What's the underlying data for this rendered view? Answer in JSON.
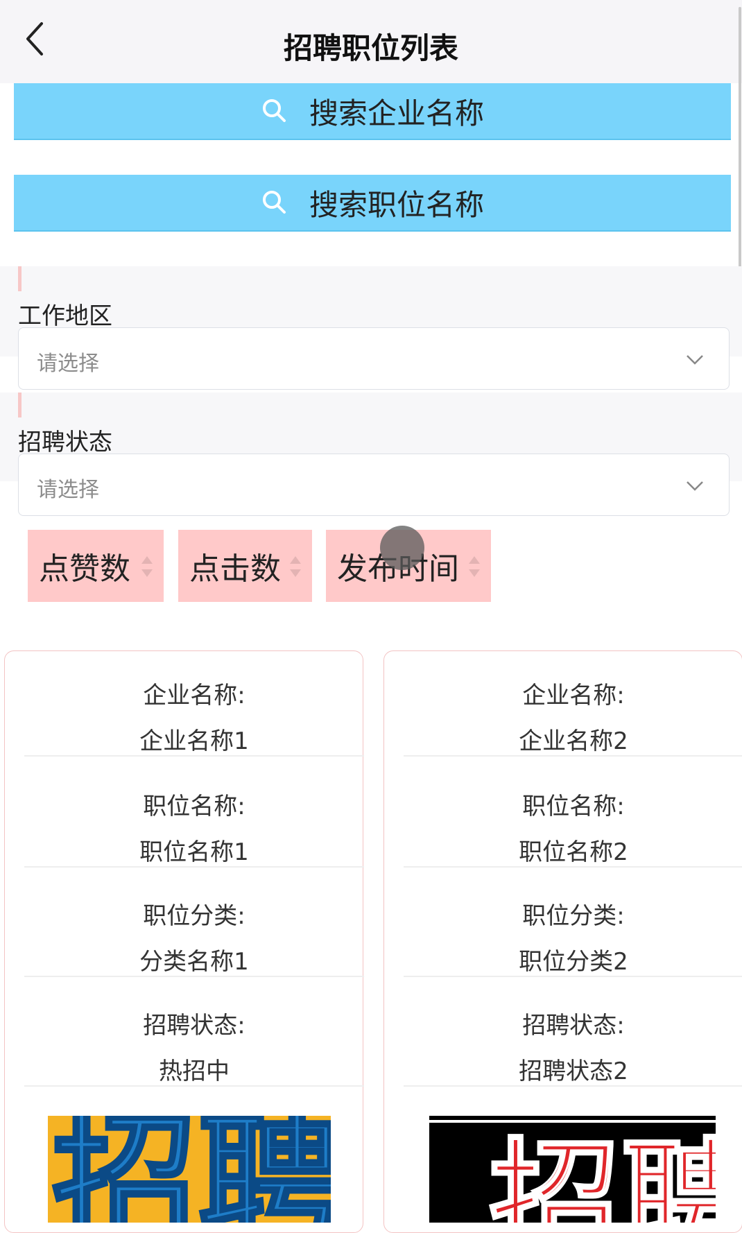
{
  "header": {
    "title": "招聘职位列表"
  },
  "search": {
    "company_button": "搜索企业名称",
    "position_button": "搜索职位名称"
  },
  "filters": {
    "region": {
      "label": "工作地区",
      "placeholder": "请选择"
    },
    "status": {
      "label": "招聘状态",
      "placeholder": "请选择"
    }
  },
  "sort": {
    "likes": "点赞数",
    "clicks": "点击数",
    "publish_time": "发布时间"
  },
  "cards": [
    {
      "company_label": "企业名称:",
      "company_value": "企业名称1",
      "position_label": "职位名称:",
      "position_value": "职位名称1",
      "category_label": "职位分类:",
      "category_value": "分类名称1",
      "status_label": "招聘状态:",
      "status_value": "热招中",
      "poster_text": "招聘"
    },
    {
      "company_label": "企业名称:",
      "company_value": "企业名称2",
      "position_label": "职位名称:",
      "position_value": "职位名称2",
      "category_label": "职位分类:",
      "category_value": "职位分类2",
      "status_label": "招聘状态:",
      "status_value": "招聘状态2",
      "poster_text": "招聘"
    }
  ],
  "colors": {
    "search_bg": "#79d4fb",
    "sort_bg": "#ffc9c9",
    "card_border": "#f3c3c3",
    "poster1_bg": "#f5b324",
    "poster1_text": "#1e7dc8",
    "poster2_bg": "#000000",
    "poster2_text": "#e0262a"
  }
}
